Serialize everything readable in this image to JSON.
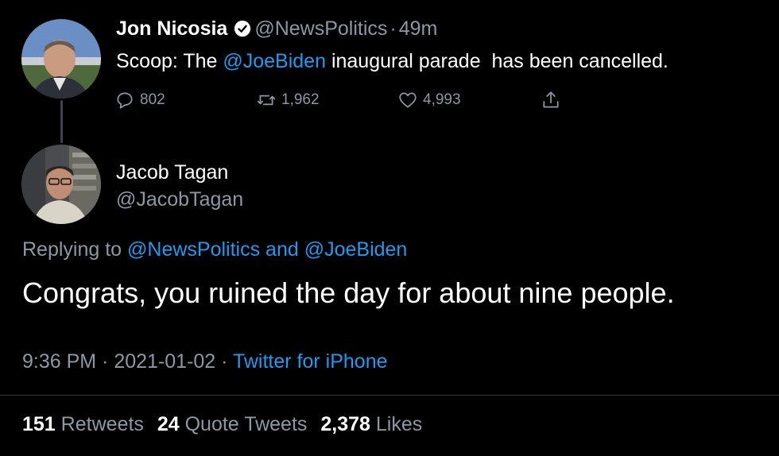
{
  "parent_tweet": {
    "display_name": "Jon Nicosia",
    "handle": "@NewsPolitics",
    "separator": "·",
    "time_ago": "49m",
    "text_before": "Scoop: The ",
    "mention": "@JoeBiden",
    "text_after": " inaugural parade  has been cancelled.",
    "replies": "802",
    "retweets": "1,962",
    "likes": "4,993"
  },
  "reply_tweet": {
    "display_name": "Jacob Tagan",
    "handle": "@JacobTagan",
    "replying_prefix": "Replying to ",
    "replying_to": "@NewsPolitics and @JoeBiden",
    "text": "Congrats, you ruined the day for about nine people.",
    "timestamp": "9:36 PM · 2021-01-02 · ",
    "source": "Twitter for iPhone"
  },
  "stats": {
    "retweets_count": "151",
    "retweets_label": "Retweets",
    "quotes_count": "24",
    "quotes_label": "Quote Tweets",
    "likes_count": "2,378",
    "likes_label": "Likes"
  },
  "colors": {
    "background": "#000000",
    "link": "#1d9bf0",
    "muted": "#8b98a5"
  }
}
